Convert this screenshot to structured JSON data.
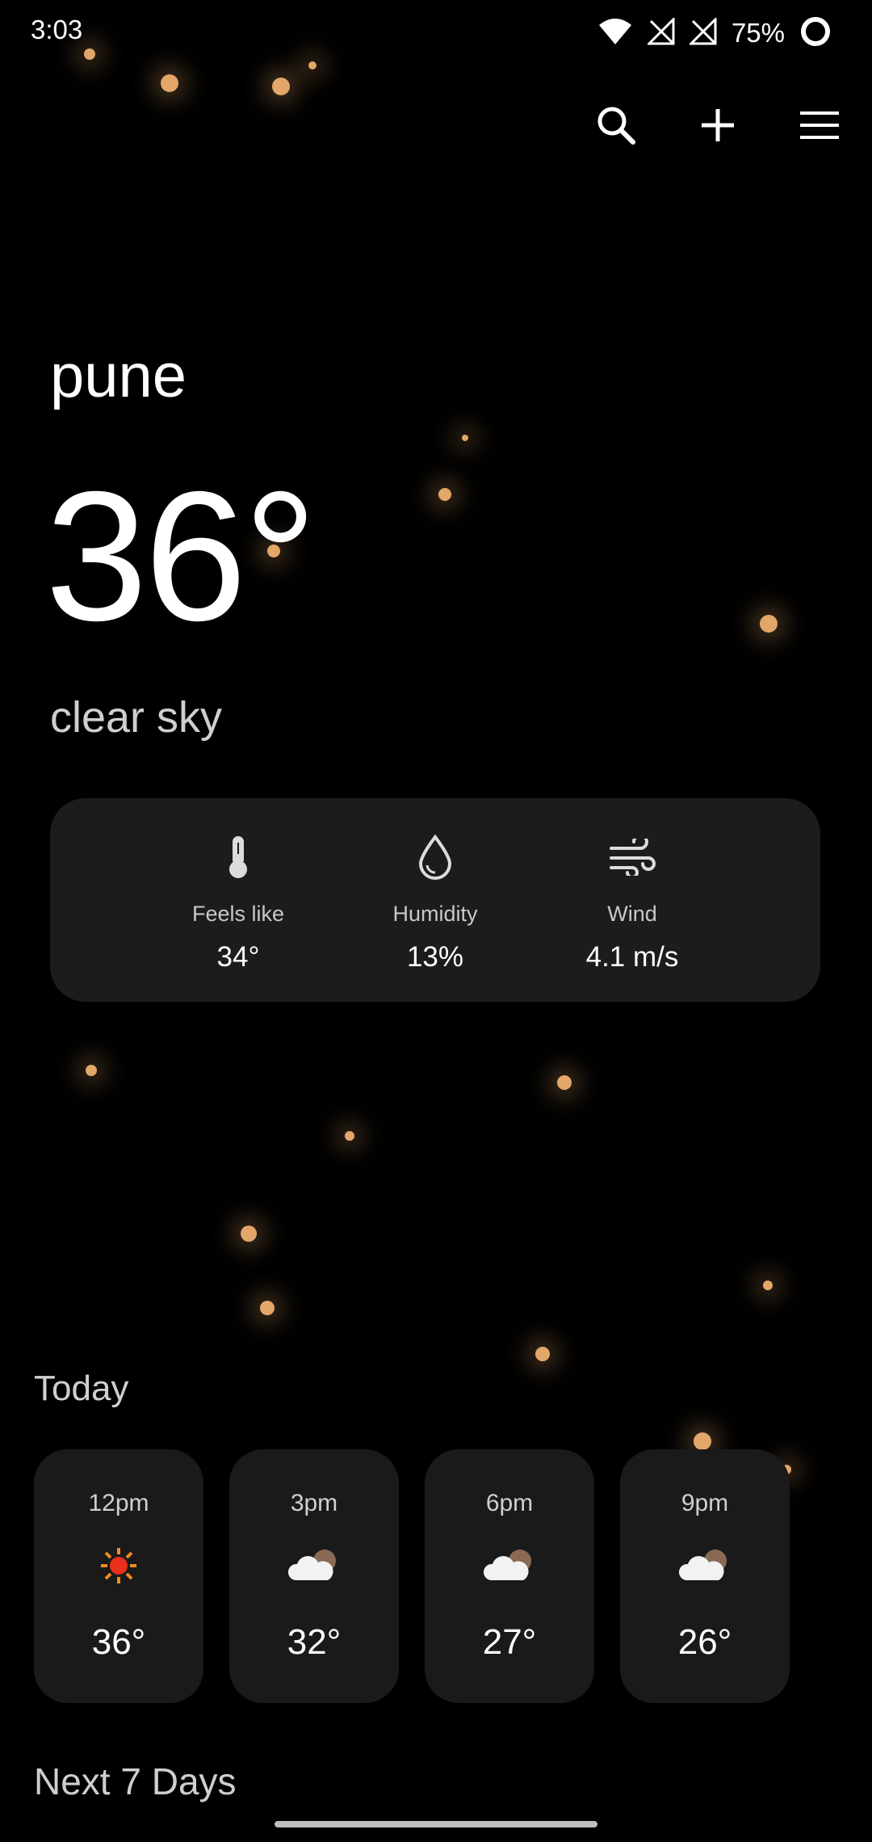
{
  "status_bar": {
    "time": "3:03",
    "battery_percent": "75%"
  },
  "location": {
    "city": "pune"
  },
  "current": {
    "temperature": "36°",
    "condition": "clear sky"
  },
  "stats": [
    {
      "label": "Feels like",
      "value": "34°",
      "icon": "thermometer-icon"
    },
    {
      "label": "Humidity",
      "value": "13%",
      "icon": "droplet-icon"
    },
    {
      "label": "Wind",
      "value": "4.1 m/s",
      "icon": "wind-icon"
    }
  ],
  "today": {
    "title": "Today",
    "hours": [
      {
        "time": "12pm",
        "temp": "36°",
        "icon": "sun-icon"
      },
      {
        "time": "3pm",
        "temp": "32°",
        "icon": "cloud-night-icon"
      },
      {
        "time": "6pm",
        "temp": "27°",
        "icon": "cloud-night-icon"
      },
      {
        "time": "9pm",
        "temp": "26°",
        "icon": "cloud-night-icon"
      }
    ]
  },
  "next_days": {
    "title": "Next 7 Days"
  },
  "colors": {
    "background": "#000000",
    "card": "#1c1c1c",
    "particle": "#e3a76a"
  }
}
